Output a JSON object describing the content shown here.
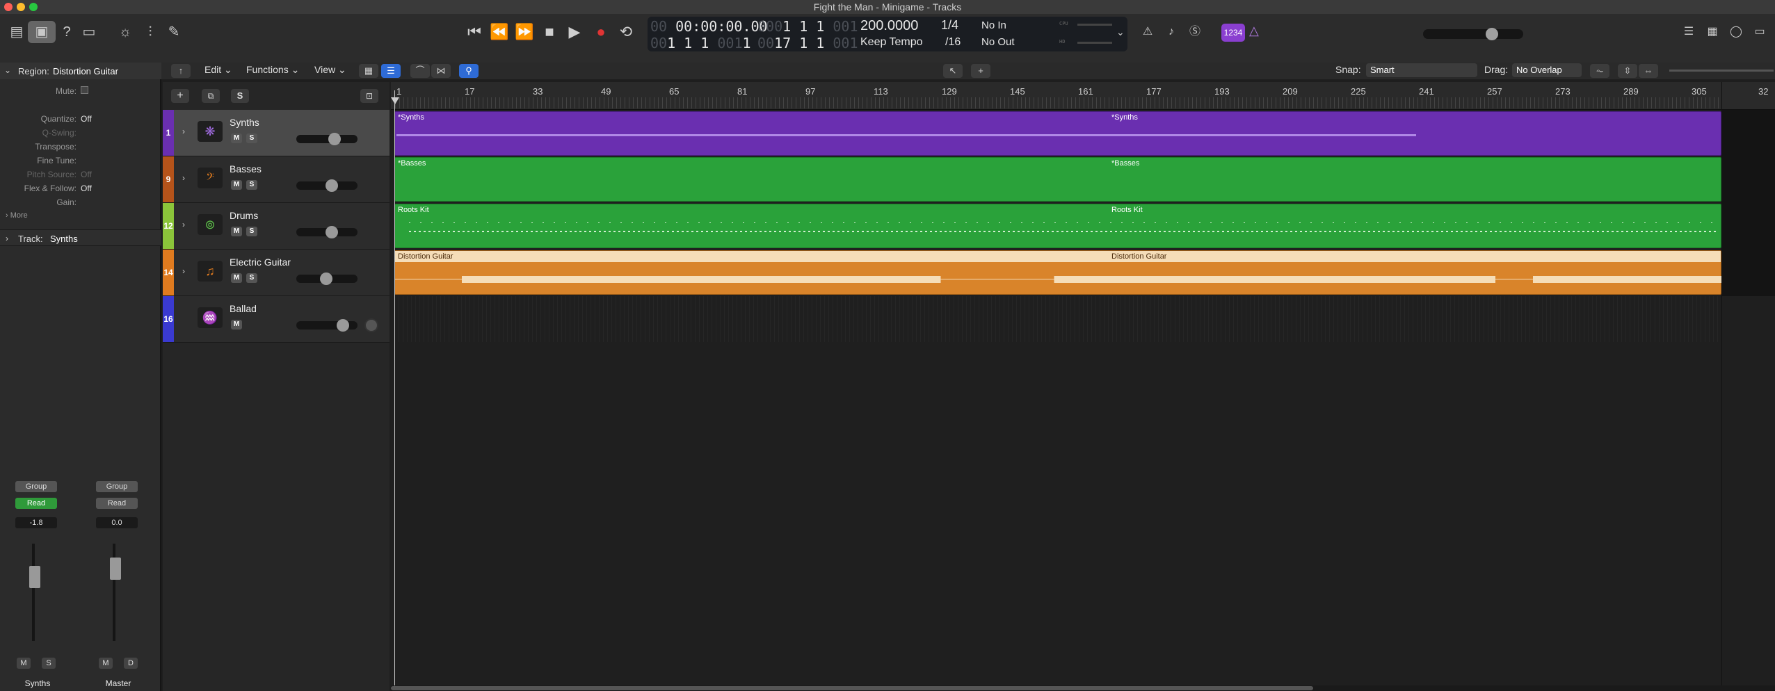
{
  "window": {
    "title": "Fight the Man - Minigame - Tracks"
  },
  "transport": {
    "time": "00:00:00.00",
    "time_dim": "00",
    "bars_top": "1  1  1",
    "bars_top_dim": "001",
    "bars_top_pre": "000",
    "bars_bottom": "1  1  1",
    "bars_bottom_pre": "00",
    "bars_bottom_tick": "1",
    "bars_bottom_dim": "001",
    "bars_right": "17  1  1",
    "bars_right_pre": "00",
    "bars_right_dim": "001",
    "tempo": "200.0000",
    "tempo_mode": "Keep Tempo",
    "signature": "1/4",
    "division": "/16",
    "in": "No In",
    "out": "No Out",
    "cpu_label": "CPU",
    "hd_label": "HD",
    "badge": "1234"
  },
  "toolbar": {
    "edit": "Edit",
    "functions": "Functions",
    "view": "View",
    "snap_label": "Snap:",
    "snap_value": "Smart",
    "drag_label": "Drag:",
    "drag_value": "No Overlap"
  },
  "inspector": {
    "region_label": "Region:",
    "region_name": "Distortion Guitar",
    "rows": [
      {
        "label": "Mute:",
        "value": ""
      },
      {
        "label": "Quantize:",
        "value": "Off"
      },
      {
        "label": "Q-Swing:",
        "value": ""
      },
      {
        "label": "Transpose:",
        "value": ""
      },
      {
        "label": "Fine Tune:",
        "value": ""
      },
      {
        "label": "Pitch Source:",
        "value": "Off"
      },
      {
        "label": "Flex & Follow:",
        "value": "Off"
      },
      {
        "label": "Gain:",
        "value": ""
      }
    ],
    "more": "More",
    "track_label": "Track:",
    "track_name": "Synths"
  },
  "channel_strips": [
    {
      "group": "Group",
      "automation": "Read",
      "volume": "-1.8",
      "btn1": "M",
      "btn2": "S",
      "name": "Synths"
    },
    {
      "group": "Group",
      "automation": "Read",
      "volume": "0.0",
      "btn1": "M",
      "btn2": "D",
      "name": "Master"
    }
  ],
  "tracks": [
    {
      "num": "1",
      "name": "Synths",
      "color": "#7b3fb8",
      "region": "*Synths",
      "region2": "*Synths"
    },
    {
      "num": "9",
      "name": "Basses",
      "color": "#b5531a",
      "region": "*Basses",
      "region2": "*Basses"
    },
    {
      "num": "12",
      "name": "Drums",
      "color": "#8bc43a",
      "region": "Roots Kit",
      "region2": "Roots Kit"
    },
    {
      "num": "14",
      "name": "Electric Guitar",
      "color": "#e07b1f",
      "region": "Distortion Guitar",
      "region2": "Distortion Guitar"
    },
    {
      "num": "16",
      "name": "Ballad",
      "color": "#3a3ad0",
      "region": "",
      "region2": ""
    }
  ],
  "track_buttons": {
    "m": "M",
    "s": "S",
    "add_s": "S"
  },
  "ruler": [
    "1",
    "17",
    "33",
    "49",
    "65",
    "81",
    "97",
    "113",
    "129",
    "145",
    "161",
    "177",
    "193",
    "209",
    "225",
    "241",
    "257",
    "273",
    "289",
    "305",
    "32"
  ],
  "colors": {
    "synth": "#6a2fb0",
    "green": "#2aa23a",
    "guitar": "#d9842a"
  }
}
